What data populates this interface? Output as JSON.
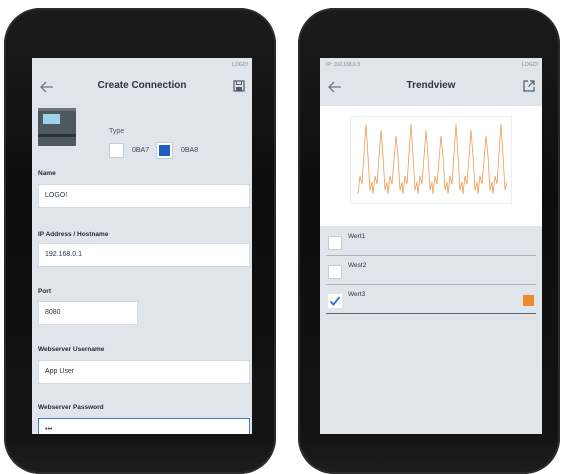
{
  "left_phone": {
    "status_right": "LOGO!",
    "title": "Create Connection",
    "type": {
      "label": "Type",
      "options": [
        "0BA7",
        "0BA8"
      ],
      "selected": "0BA8"
    },
    "fields": [
      {
        "label": "Name",
        "value": "LOGO!"
      },
      {
        "label": "IP Address / Hostname",
        "value": "192.168.0.1"
      },
      {
        "label": "Port",
        "value": "8080"
      },
      {
        "label": "Webserver Username",
        "value": "App User"
      },
      {
        "label": "Webserver Password",
        "value": "•••"
      }
    ],
    "icons": {
      "back": "back-arrow-icon",
      "save": "save-icon"
    }
  },
  "right_phone": {
    "status_left": "IP: 192.168.0.3",
    "status_right": "LOGO!",
    "title": "Trendview",
    "icons": {
      "back": "back-arrow-icon",
      "export": "open-external-icon"
    },
    "series": [
      {
        "name": "Wert1",
        "checked": false
      },
      {
        "name": "West2",
        "checked": false
      },
      {
        "name": "Wert3",
        "checked": true,
        "color": "#ee8a2e"
      }
    ],
    "line_color": "#ee9b52"
  },
  "colors": {
    "accent_blue": "#1f5fbf",
    "check_blue": "#1f6fd1",
    "trend_orange": "#ee8a2e"
  }
}
